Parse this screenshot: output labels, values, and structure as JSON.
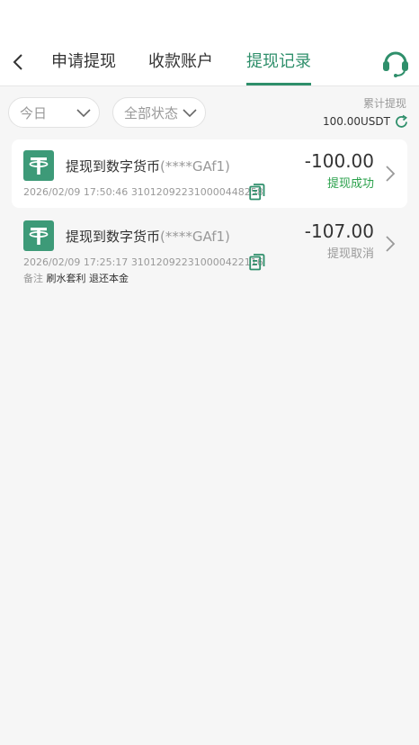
{
  "header": {
    "tabs": [
      {
        "label": "申请提现",
        "active": false
      },
      {
        "label": "收款账户",
        "active": false
      },
      {
        "label": "提现记录",
        "active": true
      }
    ],
    "back_icon": "chevron-left-icon",
    "support_icon": "headset-icon"
  },
  "filters": {
    "date": "今日",
    "status": "全部状态"
  },
  "summary": {
    "label": "累计提现",
    "value": "100.00USDT"
  },
  "records": [
    {
      "title": "提现到数字货币",
      "masked": "(****GAf1)",
      "datetime": "2026/02/09 17:50:46",
      "order_no": "310120922310000448258",
      "amount": "-100.00",
      "status": "提现成功",
      "note_label": "",
      "note": ""
    },
    {
      "title": "提现到数字货币",
      "masked": "(****GAf1)",
      "datetime": "2026/02/09 17:25:17",
      "order_no": "310120922310000422116",
      "amount": "-107.00",
      "status": "提现取消",
      "note_label": "备注",
      "note": "刷水套利 退还本金"
    }
  ],
  "colors": {
    "accent": "#2f8f6b",
    "success": "#2aa14b",
    "usdt": "#3d9a78"
  }
}
